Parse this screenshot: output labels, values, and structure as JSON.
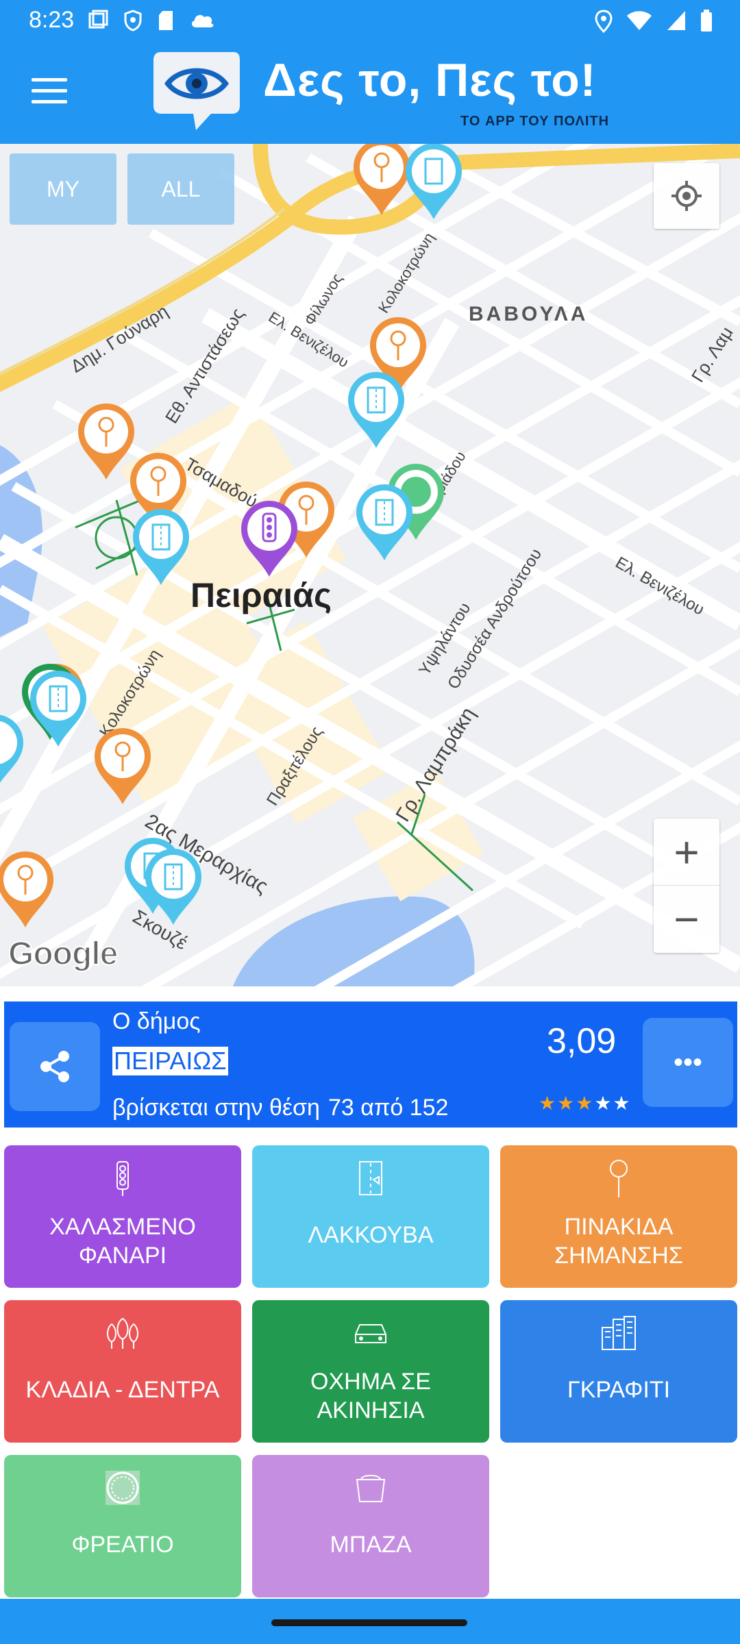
{
  "status_bar": {
    "time": "8:23"
  },
  "header": {
    "brand": "Δες το, Πες το!",
    "tagline": "ΤΟ APP ΤΟΥ ΠΟΛΙΤΗ"
  },
  "map": {
    "filter_buttons": [
      "MY",
      "ALL"
    ],
    "city": "Πειραιάς",
    "district": "ΒΑΒΟΥΛΑ",
    "google": "Google",
    "streets": [
      "Δημ. Γούναρη",
      "Εθ. Αντιστάσεως",
      "Ελ. Βενιζέλου",
      "Φίλωνος",
      "Κολοκοτρώνη",
      "Τσαμαδού",
      "Ιβιάδου",
      "Γρ. Λαμπράκη",
      "Υψηλάντου",
      "Οδυσσέα Ανδρούτσου",
      "Πραξιτέλους",
      "2ας Μεραρχίας",
      "Σκουζέ",
      "Κολοκοτρώνη",
      "Ελ. Βενιζέλου",
      "Γρ. Λαμ"
    ],
    "zoom_in": "+",
    "zoom_out": "−",
    "pin_colors": {
      "orange": "#f0913b",
      "blue": "#4ec4ec",
      "purple": "#9b4fd8",
      "green": "#58c887"
    }
  },
  "info": {
    "line1": "Ο δήμος",
    "municipality": "ΠΕΙΡΑΙΩΣ",
    "line3": "βρίσκεται στην θέση",
    "position": "73 από 152",
    "score": "3,09",
    "stars": 3,
    "more": "•••"
  },
  "categories": [
    {
      "label": "ΧΑΛΑΣΜΕΝΟ\nΦΑΝΑΡΙ",
      "color": "#9c4fe0",
      "icon": "traffic-light-icon"
    },
    {
      "label": "ΛΑΚΚΟΥΒΑ",
      "color": "#5ccbf0",
      "icon": "pothole-icon"
    },
    {
      "label": "ΠΙΝΑΚΙΔΑ\nΣΗΜΑΝΣΗΣ",
      "color": "#f19644",
      "icon": "road-sign-icon"
    },
    {
      "label": "ΚΛΑΔΙΑ - ΔΕΝΤΡΑ",
      "color": "#eb5456",
      "icon": "trees-icon"
    },
    {
      "label": "ΟΧΗΜΑ ΣΕ\nΑΚΙΝΗΣΙΑ",
      "color": "#229a50",
      "icon": "car-icon"
    },
    {
      "label": "ΓΚΡΑΦΙΤΙ",
      "color": "#2f82e8",
      "icon": "buildings-icon"
    },
    {
      "label": "ΦΡΕΑΤΙΟ",
      "color": "#6fd08f",
      "icon": "manhole-icon"
    },
    {
      "label": "ΜΠΑΖΑ",
      "color": "#c58ee0",
      "icon": "debris-bin-icon"
    }
  ]
}
